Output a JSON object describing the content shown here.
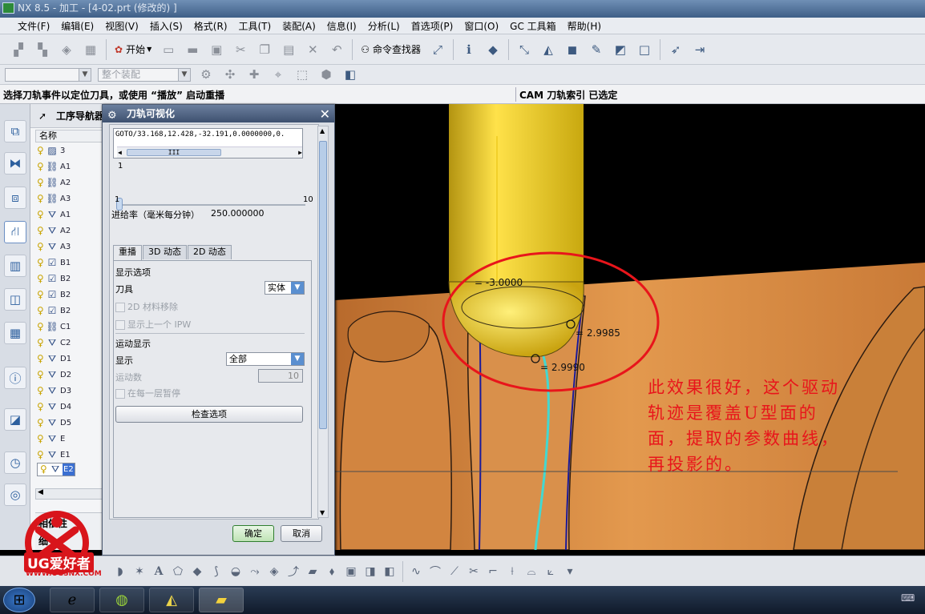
{
  "window": {
    "title": "NX 8.5 - 加工 - [4-02.prt  (修改的) ]"
  },
  "menu": {
    "items": [
      "文件(F)",
      "编辑(E)",
      "视图(V)",
      "插入(S)",
      "格式(R)",
      "工具(T)",
      "装配(A)",
      "信息(I)",
      "分析(L)",
      "首选项(P)",
      "窗口(O)",
      "GC 工具箱",
      "帮助(H)"
    ]
  },
  "toolbar": {
    "start_label": "开始",
    "command_finder_label": "命令查找器"
  },
  "selection_bar": {
    "filter_value": "",
    "scope_value": "整个装配"
  },
  "status": {
    "prompt": "选择刀轨事件以定位刀具，或使用 “播放” 启动重播",
    "right": "CAM 刀轨索引 已选定"
  },
  "navigator": {
    "title": "工序导航器",
    "column_name": "名称",
    "rows": [
      "3",
      "A1",
      "A2",
      "A3",
      "A1",
      "A2",
      "A3",
      "B1",
      "B2",
      "B2",
      "B2",
      "C1",
      "C2",
      "D1",
      "D2",
      "D3",
      "D4",
      "D5",
      "E",
      "E1",
      "E2"
    ],
    "dependency_label": "相依性",
    "detail_label": "细"
  },
  "dialog": {
    "title": "刀轨可视化",
    "goto_text": "GOTO/33.168,12.428,-32.191,0.0000000,0.",
    "slider_value": "1",
    "slider_min": "1",
    "slider_max": "10",
    "feed_label": "进给率（毫米每分钟）",
    "feed_value": "250.000000",
    "tabs": [
      "重播",
      "3D 动态",
      "2D 动态"
    ],
    "display_options_label": "显示选项",
    "tool_label": "刀具",
    "tool_value": "实体",
    "material_removal_label": "2D 材料移除",
    "show_prev_ipw_label": "显示上一个 IPW",
    "motion_display_label": "运动显示",
    "display_label": "显示",
    "display_value": "全部",
    "motion_count_label": "运动数",
    "motion_count_value": "10",
    "pause_label": "在每一层暂停",
    "check_options_label": "检查选项",
    "ok_label": "确定",
    "cancel_label": "取消"
  },
  "viewport": {
    "dims": [
      "= -3.0000",
      "= 2.9985",
      "= 2.9990"
    ],
    "annotation": [
      "此效果很好，这个驱动",
      "轨迹是覆盖U型面的",
      "面，提取的参数曲线，",
      "再投影的。"
    ]
  },
  "watermark": {
    "brand": "UG爱好者",
    "url": "WWW.UGSNX.COM"
  },
  "colors": {
    "part": "#d78a40",
    "tool": "#e6c51a",
    "annotation": "#e8151b",
    "path": "#43d8d0"
  }
}
